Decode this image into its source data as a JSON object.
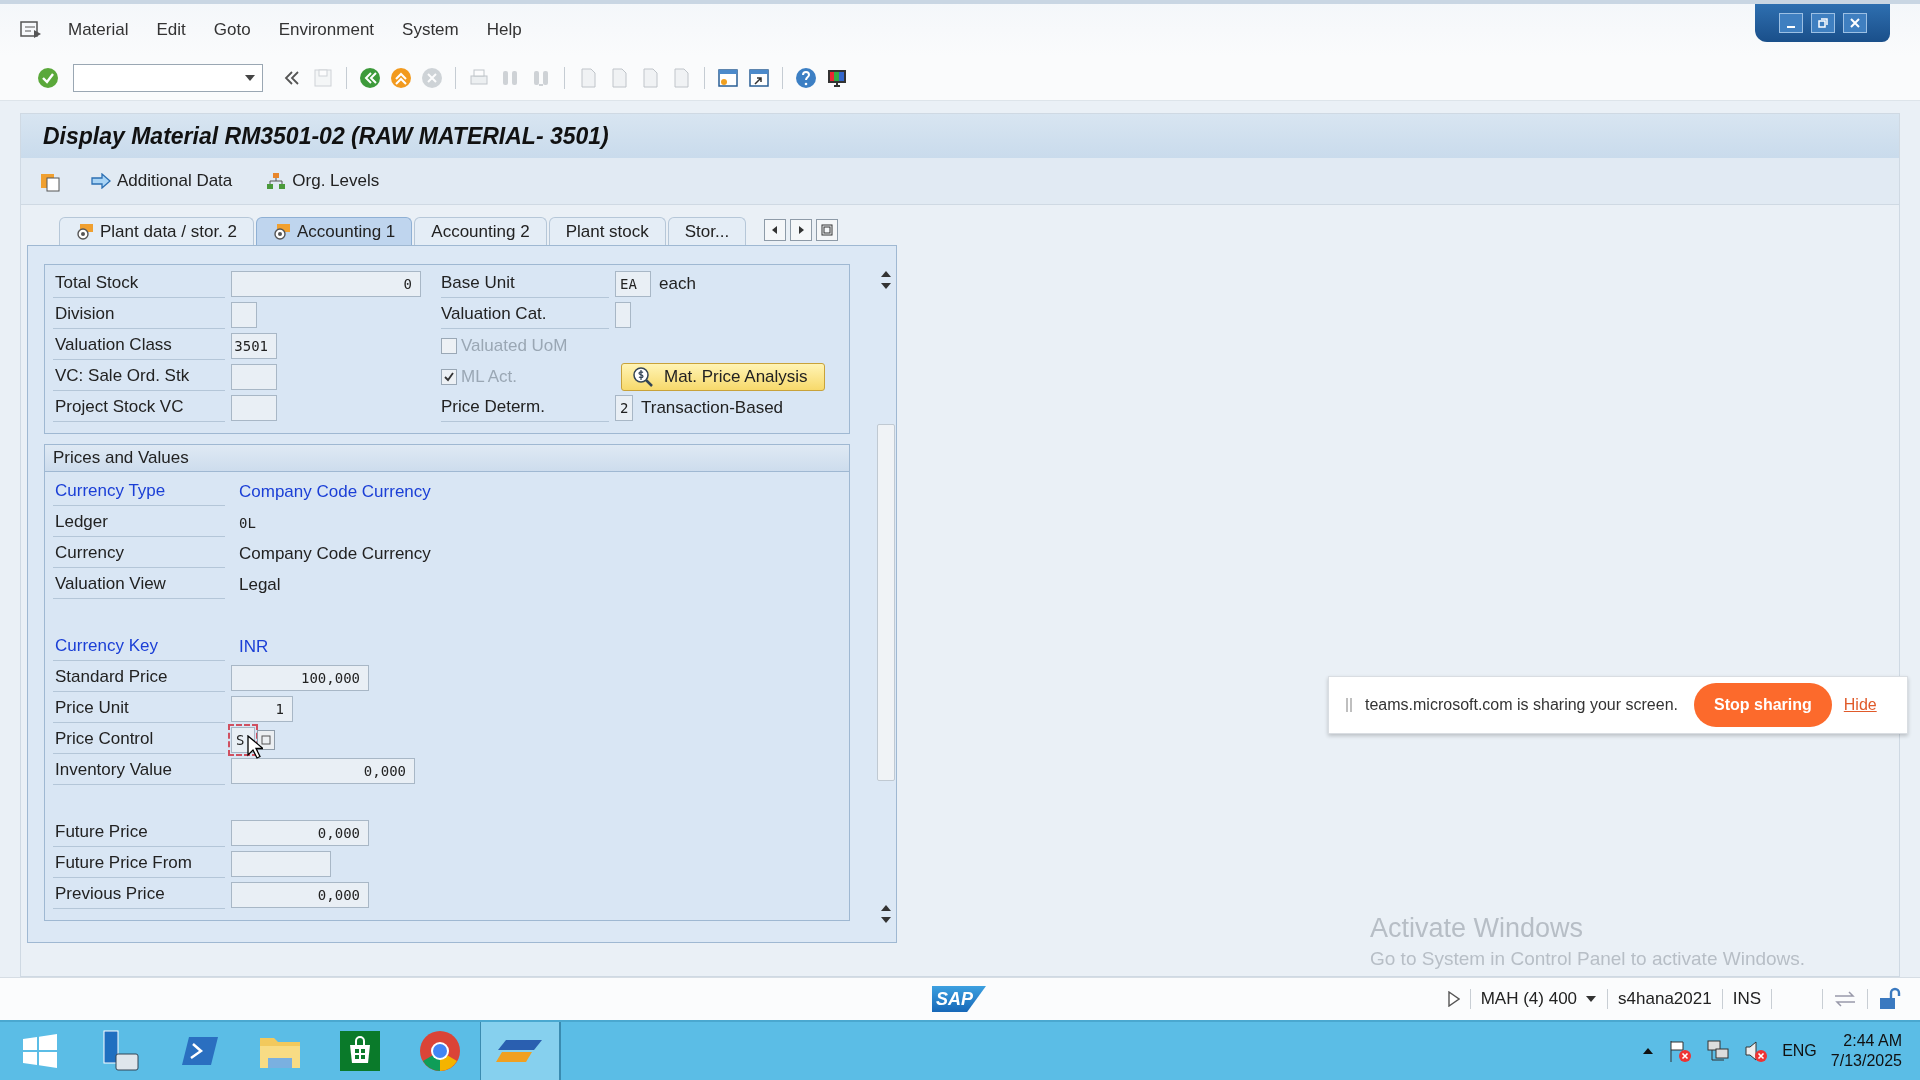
{
  "menu": [
    {
      "label": "Material"
    },
    {
      "label": "Edit"
    },
    {
      "label": "Goto"
    },
    {
      "label": "Environment"
    },
    {
      "label": "System"
    },
    {
      "label": "Help"
    }
  ],
  "window": {
    "title": "Display Material RM3501-02 (RAW MATERIAL- 3501)"
  },
  "app_toolbar": [
    {
      "label": "Additional Data",
      "kind": "arrow"
    },
    {
      "label": "Org. Levels",
      "kind": "hierarchy"
    }
  ],
  "tabs": [
    {
      "label": "Plant data / stor. 2",
      "selected": false,
      "has_icon": true
    },
    {
      "label": "Accounting 1",
      "selected": true,
      "has_icon": true
    },
    {
      "label": "Accounting 2",
      "selected": false,
      "has_icon": false
    },
    {
      "label": "Plant stock",
      "selected": false,
      "has_icon": false
    },
    {
      "label": "Stor...",
      "selected": false,
      "has_icon": false
    }
  ],
  "general": {
    "left": [
      {
        "label": "Total Stock",
        "value": "0"
      },
      {
        "label": "Division"
      },
      {
        "label": "Valuation Class",
        "value": "3501"
      },
      {
        "label": "VC: Sale Ord. Stk"
      },
      {
        "label": "Project Stock VC"
      }
    ],
    "right": [
      {
        "kind": "field",
        "label": "Base Unit",
        "value": "EA",
        "text": "each"
      },
      {
        "kind": "field",
        "label": "Valuation Cat."
      },
      {
        "kind": "checkbox",
        "label": "Valuated UoM",
        "checked": false,
        "disabled": true
      },
      {
        "kind": "checkbox",
        "label": "ML Act.",
        "checked": true,
        "disabled": true,
        "button": "Mat. Price Analysis"
      },
      {
        "kind": "field",
        "label": "Price Determ.",
        "value": "2",
        "text": "Transaction-Based"
      }
    ]
  },
  "prices": {
    "title": "Prices and Values",
    "groups": [
      [
        {
          "label": "Currency Type",
          "value": "Company Code Currency",
          "kind": "text",
          "emphasized": true
        },
        {
          "label": "Ledger",
          "value": "0L",
          "kind": "text",
          "emphasized": false
        },
        {
          "label": "Currency",
          "value": "Company Code Currency",
          "kind": "text",
          "emphasized": false
        },
        {
          "label": "Valuation View",
          "value": "Legal",
          "kind": "text",
          "emphasized": false
        }
      ],
      [
        {
          "label": "Currency Key",
          "value": "INR",
          "kind": "text",
          "emphasized": true
        },
        {
          "label": "Standard Price",
          "value": "100,000",
          "kind": "field",
          "emphasized": false
        },
        {
          "label": "Price Unit",
          "value": "1",
          "kind": "field",
          "emphasized": false
        },
        {
          "label": "Price Control",
          "value": "S",
          "kind": "dropdown",
          "emphasized": false,
          "focused": true
        },
        {
          "label": "Inventory Value",
          "value": "0,000",
          "kind": "field",
          "emphasized": false
        }
      ],
      [
        {
          "label": "Future Price",
          "value": "0,000",
          "kind": "field",
          "emphasized": false
        },
        {
          "label": "Future Price From",
          "kind": "field",
          "emphasized": false
        },
        {
          "label": "Previous Price",
          "value": "0,000",
          "kind": "field",
          "emphasized": false
        }
      ]
    ]
  },
  "sharing_banner": {
    "text": "teams.microsoft.com is sharing your screen.",
    "button": "Stop sharing",
    "link": "Hide"
  },
  "activation_notice": {
    "title": "Activate Windows",
    "text": "Go to System in Control Panel to activate Windows."
  },
  "status_bar": {
    "logo": "SAP",
    "items": [
      {
        "label": "MAH (4) 400",
        "kind": "dropdown"
      },
      {
        "label": "s4hana2021",
        "kind": "text"
      },
      {
        "label": "INS",
        "kind": "text"
      }
    ]
  },
  "taskbar": {
    "language": "ENG",
    "time": "2:44 AM",
    "date": "7/13/2025"
  }
}
